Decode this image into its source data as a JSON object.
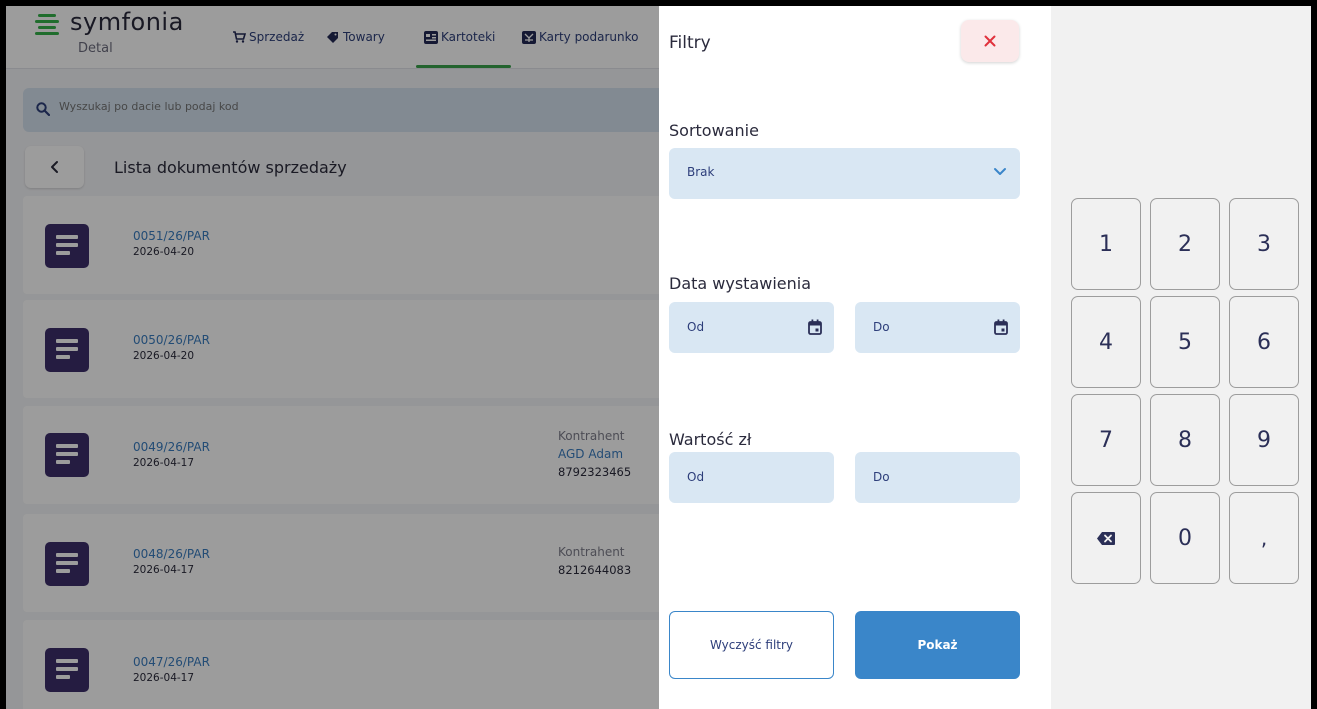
{
  "app": {
    "logo_text": "symfonia",
    "logo_sub": "Detal",
    "nav": [
      {
        "label": "Sprzedaż",
        "icon": "cart-icon"
      },
      {
        "label": "Towary",
        "icon": "tag-icon"
      },
      {
        "label": "Kartoteki",
        "icon": "cards-icon"
      },
      {
        "label": "Karty podarunko",
        "icon": "gift-card-icon"
      }
    ],
    "active_nav": "Kartoteki",
    "search_placeholder": "Wyszukaj po dacie lub podaj kod",
    "list_title": "Lista dokumentów sprzedaży",
    "documents": [
      {
        "number": "0051/26/PAR",
        "date": "2026-04-20",
        "contractor_label": "",
        "contractor_name": "",
        "contractor_nip": ""
      },
      {
        "number": "0050/26/PAR",
        "date": "2026-04-20",
        "contractor_label": "",
        "contractor_name": "",
        "contractor_nip": ""
      },
      {
        "number": "0049/26/PAR",
        "date": "2026-04-17",
        "contractor_label": "Kontrahent",
        "contractor_name": "AGD Adam",
        "contractor_nip": "8792323465"
      },
      {
        "number": "0048/26/PAR",
        "date": "2026-04-17",
        "contractor_label": "Kontrahent",
        "contractor_name": "",
        "contractor_nip": "8212644083"
      },
      {
        "number": "0047/26/PAR",
        "date": "2026-04-17",
        "contractor_label": "",
        "contractor_name": "",
        "contractor_nip": ""
      }
    ]
  },
  "filters": {
    "title": "Filtry",
    "sort_label": "Sortowanie",
    "sort_value": "Brak",
    "date_label": "Data wystawienia",
    "date_from": "Od",
    "date_to": "Do",
    "value_label": "Wartość zł",
    "value_from": "Od",
    "value_to": "Do",
    "clear_button": "Wyczyść filtry",
    "show_button": "Pokaż"
  },
  "numpad": {
    "keys": [
      "1",
      "2",
      "3",
      "4",
      "5",
      "6",
      "7",
      "8",
      "9",
      "⌫",
      "0",
      ","
    ]
  },
  "colors": {
    "brand_green": "#35b24a",
    "primary_blue": "#3a86c9",
    "field_bg": "#d9e7f3",
    "doc_icon": "#3d2f6b",
    "close_red": "#e0313c"
  }
}
